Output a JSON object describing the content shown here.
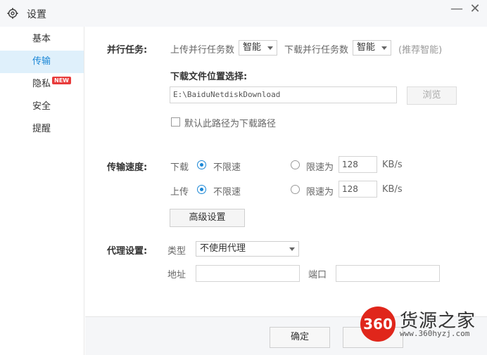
{
  "window": {
    "title": "设置",
    "icon": "gear-icon",
    "minimize_symbol": "—",
    "close_symbol": "✕"
  },
  "sidebar": {
    "items": [
      {
        "label": "基本",
        "active": false
      },
      {
        "label": "传输",
        "active": true
      },
      {
        "label": "隐私",
        "active": false,
        "badge": "NEW"
      },
      {
        "label": "安全",
        "active": false
      },
      {
        "label": "提醒",
        "active": false
      }
    ]
  },
  "parallel": {
    "section_label": "并行任务:",
    "upload_label": "上传并行任务数",
    "upload_value": "智能",
    "download_label": "下载并行任务数",
    "download_value": "智能",
    "hint": "(推荐智能)"
  },
  "download_location": {
    "label": "下载文件位置选择:",
    "path": "E:\\BaiduNetdiskDownload",
    "browse_label": "浏览",
    "default_checkbox_label": "默认此路径为下载路径",
    "default_checked": false
  },
  "speed": {
    "section_label": "传输速度:",
    "download": {
      "label": "下载",
      "unlimited_label": "不限速",
      "limit_label": "限速为",
      "limit_value": "128",
      "unit": "KB/s",
      "selected": "unlimited"
    },
    "upload": {
      "label": "上传",
      "unlimited_label": "不限速",
      "limit_label": "限速为",
      "limit_value": "128",
      "unit": "KB/s",
      "selected": "unlimited"
    },
    "advanced_label": "高级设置"
  },
  "proxy": {
    "section_label": "代理设置:",
    "type_label": "类型",
    "type_value": "不使用代理",
    "address_label": "地址",
    "address_value": "",
    "port_label": "端口",
    "port_value": ""
  },
  "footer": {
    "ok_label": "确定"
  },
  "watermark": {
    "logo_text": "360",
    "title": "货源之家",
    "url": "www.360hyzj.com",
    "logo_color": "#e0261b"
  },
  "colors": {
    "accent": "#1b87d6",
    "active_bg": "#dff0fb",
    "badge": "#e83b3b"
  }
}
